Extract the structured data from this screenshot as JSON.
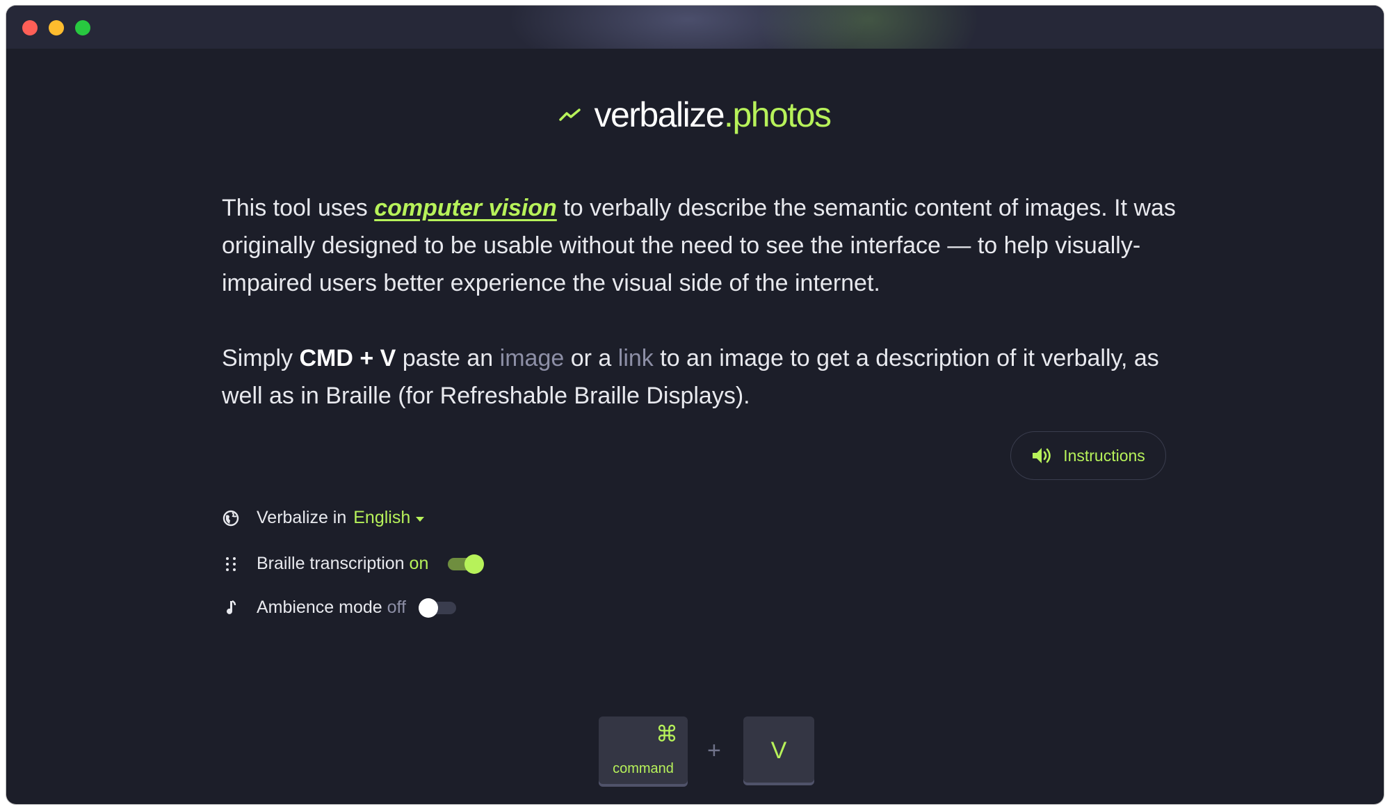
{
  "window": {
    "controls": [
      "close",
      "minimize",
      "maximize"
    ]
  },
  "logo": {
    "name_main": "verbalize",
    "name_accent": ".photos",
    "icon": "trend-line-icon"
  },
  "intro": {
    "text_before": "This tool uses ",
    "link_text": "computer vision",
    "text_after": " to verbally describe the semantic content of images. It was originally designed to be usable without the need to see the interface — to help visually-impaired users better experience the visual side of the internet."
  },
  "paste": {
    "text_1": "Simply ",
    "shortcut": "CMD + V",
    "text_2": " paste an ",
    "image_link": "image",
    "text_3": " or a ",
    "link_link": "link",
    "text_4": " to an image to get a description of it verbally, as well as in Braille (for Refreshable Braille Displays)."
  },
  "instructions_button": {
    "label": "Instructions",
    "icon": "speaker-icon"
  },
  "settings": {
    "language": {
      "label": "Verbalize in",
      "value": "English",
      "icon": "globe-icon"
    },
    "braille": {
      "label": "Braille transcription",
      "state_text": "on",
      "enabled": true,
      "icon": "braille-icon"
    },
    "ambience": {
      "label": "Ambience mode",
      "state_text": "off",
      "enabled": false,
      "icon": "music-note-icon"
    }
  },
  "keys": {
    "command_symbol": "⌘",
    "command_label": "command",
    "plus": "+",
    "v_label": "V"
  },
  "colors": {
    "accent": "#b7f25a",
    "background": "#1c1e29",
    "muted": "#8d8fa6"
  }
}
